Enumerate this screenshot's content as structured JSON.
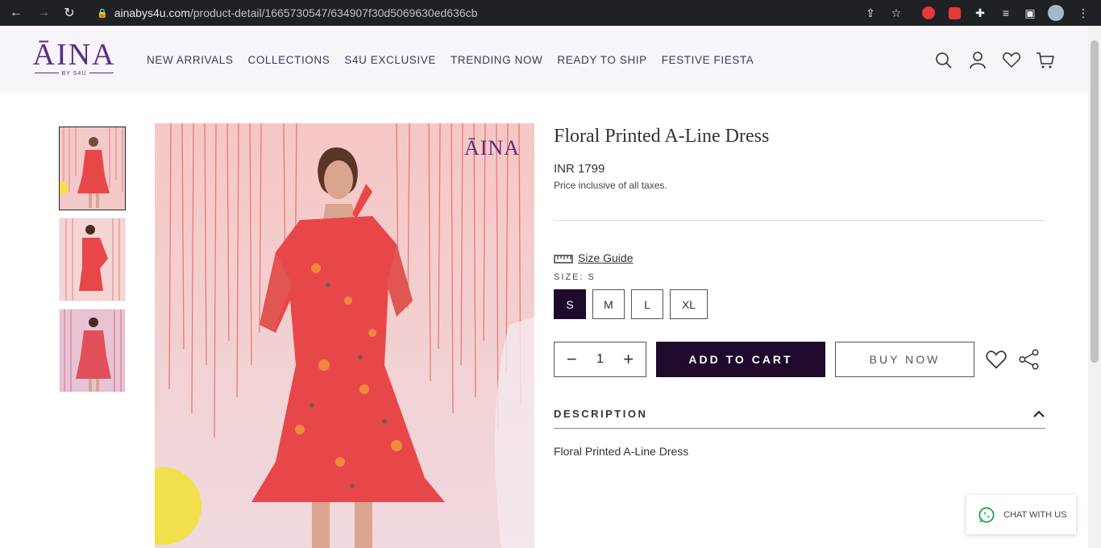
{
  "browser": {
    "url_host": "ainabys4u.com",
    "url_path": "/product-detail/1665730547/634907f30d5069630ed636cb"
  },
  "header": {
    "logo_main": "ĀINA",
    "logo_sub": "BY S4U",
    "menu": [
      "NEW ARRIVALS",
      "COLLECTIONS",
      "S4U EXCLUSIVE",
      "TRENDING NOW",
      "READY TO SHIP",
      "FESTIVE FIESTA"
    ]
  },
  "product": {
    "title": "Floral Printed A-Line Dress",
    "price": "INR 1799",
    "tax_note": "Price inclusive of all taxes.",
    "size_guide": "Size Guide",
    "size_label": "SIZE:  S",
    "sizes": [
      "S",
      "M",
      "L",
      "XL"
    ],
    "selected_size": "S",
    "quantity": "1",
    "add_to_cart": "ADD TO CART",
    "buy_now": "BUY NOW",
    "description_heading": "DESCRIPTION",
    "description_text": "Floral Printed A-Line Dress",
    "watermark": "ĀINA"
  },
  "chat": {
    "label": "CHAT WITH US"
  },
  "colors": {
    "brand": "#5b2d82",
    "primary_button": "#1f0a2e",
    "dress": "#e8474a"
  }
}
